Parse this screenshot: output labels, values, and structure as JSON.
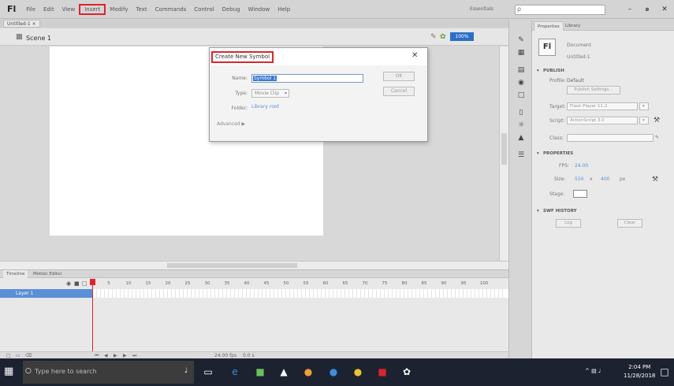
{
  "menubar": {
    "logo": "Fl",
    "items": [
      "File",
      "Edit",
      "View",
      "Insert",
      "Modify",
      "Text",
      "Commands",
      "Control",
      "Debug",
      "Window",
      "Help"
    ],
    "highlighted": "Insert",
    "workspace": "Essentials",
    "search_placeholder": "ρ",
    "win_min": "–",
    "win_max": "๑",
    "win_close": "✕"
  },
  "document": {
    "tab_label": "Untitled-1 ×",
    "scene_label": "Scene 1",
    "zoom": "100%"
  },
  "dialog": {
    "title": "Create New Symbol",
    "close": "✕",
    "name_label": "Name:",
    "name_value": "Symbol 1",
    "type_label": "Type:",
    "type_value": "Movie Clip",
    "folder_label": "Folder:",
    "folder_value": "Library root",
    "advanced": "Advanced ▶",
    "ok": "OK",
    "cancel": "Cancel"
  },
  "timeline": {
    "tabs": [
      "Timeline",
      "Motion Editor"
    ],
    "frame_numbers": [
      "5",
      "10",
      "15",
      "20",
      "25",
      "30",
      "35",
      "40",
      "45",
      "50",
      "55",
      "60",
      "65",
      "70",
      "75",
      "80",
      "85",
      "90",
      "95",
      "100"
    ],
    "layer_name": "Layer 1",
    "fps_readout": "24.00 fps",
    "time_readout": "0.0 s"
  },
  "properties": {
    "tabs": [
      "Properties",
      "Library"
    ],
    "doc_type": "Document",
    "doc_name": "Untitled-1",
    "publish_header": "PUBLISH",
    "profile_label": "Profile:",
    "profile_value": "Default",
    "publish_settings": "Publish Settings...",
    "target_label": "Target:",
    "target_value": "Flash Player 11.2",
    "script_label": "Script:",
    "script_value": "ActionScript 3.0",
    "class_label": "Class:",
    "properties_header": "PROPERTIES",
    "fps_label": "FPS:",
    "fps_value": "24.00",
    "size_label": "Size:",
    "width": "550",
    "x": "x",
    "height": "400",
    "px": "px",
    "stage_label": "Stage:",
    "swf_header": "SWF HISTORY",
    "log": "Log",
    "clear": "Clear"
  },
  "taskbar": {
    "search_placeholder": "Type here to search",
    "time": "2:04 PM",
    "date": "11/28/2018"
  },
  "colors": {
    "highlight_red": "#e0232b",
    "selection_blue": "#3a78d4"
  }
}
